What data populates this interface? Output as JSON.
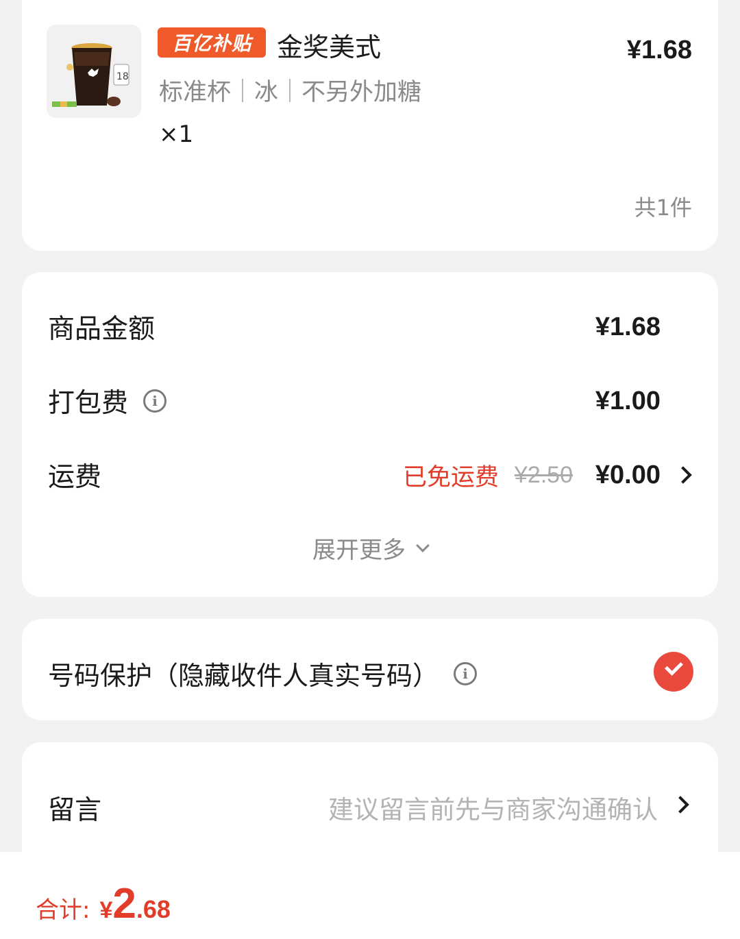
{
  "product": {
    "badge": "百亿补贴",
    "name": "金奖美式",
    "price": "¥1.68",
    "specs": [
      "标准杯",
      "冰",
      "不另外加糖"
    ],
    "quantity": "×1",
    "total_count": "共1件",
    "image_icon": "iced-americano-cup-image"
  },
  "fees": {
    "goods_label": "商品金额",
    "goods_amount": "¥1.68",
    "packing_label": "打包费",
    "packing_amount": "¥1.00",
    "delivery_label": "运费",
    "delivery_free_text": "已免运费",
    "delivery_original": "¥2.50",
    "delivery_amount": "¥0.00",
    "expand_label": "展开更多"
  },
  "protection": {
    "label": "号码保护（隐藏收件人真实号码）",
    "checked": true
  },
  "message": {
    "label": "留言",
    "placeholder": "建议留言前先与商家沟通确认"
  },
  "footer": {
    "total_label": "合计:",
    "currency": "¥",
    "total_int": "2",
    "total_dec": ".68"
  },
  "colors": {
    "accent_red": "#e23d2b",
    "badge_orange": "#ef5a2a",
    "check_red": "#ea4a3e"
  }
}
